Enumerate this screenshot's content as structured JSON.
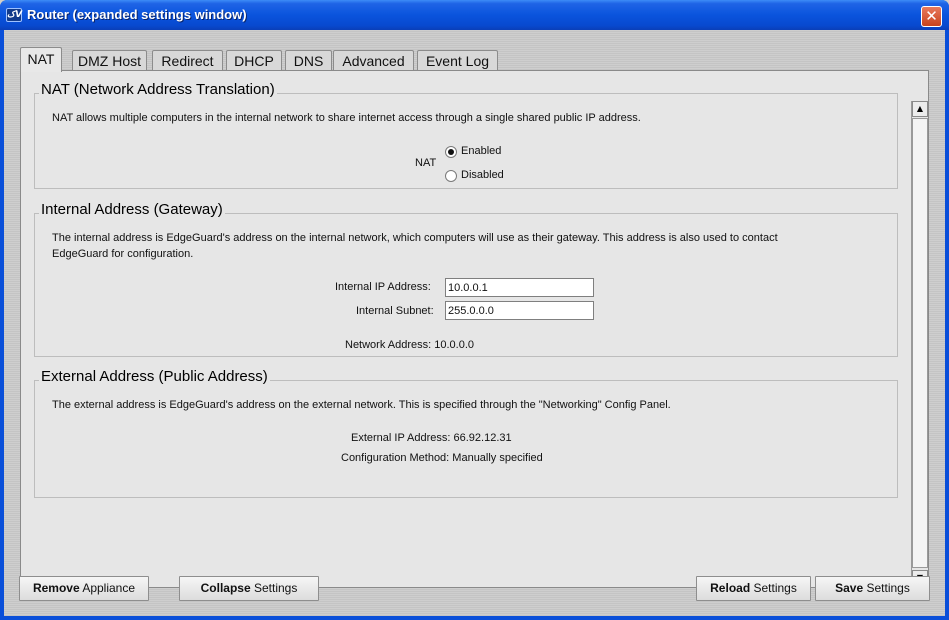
{
  "window": {
    "title": "Router (expanded settings window)",
    "app_icon_text": "کV",
    "close_glyph": "✕"
  },
  "tabs": [
    {
      "label": "NAT",
      "active": true
    },
    {
      "label": "DMZ Host"
    },
    {
      "label": "Redirect"
    },
    {
      "label": "DHCP"
    },
    {
      "label": "DNS"
    },
    {
      "label": "Advanced"
    },
    {
      "label": "Event Log"
    }
  ],
  "nat": {
    "title": "NAT (Network Address Translation)",
    "description": "NAT allows multiple computers in the internal network to share internet access through a single shared public IP address.",
    "field_label": "NAT",
    "options": [
      {
        "label": "Enabled",
        "selected": true
      },
      {
        "label": "Disabled",
        "selected": false
      }
    ]
  },
  "internal": {
    "title": "Internal Address (Gateway)",
    "description_line1": "The internal address is EdgeGuard's address on the internal network, which computers will use as their gateway.  This address is also used to contact",
    "description_line2": "EdgeGuard for configuration.",
    "ip_label": "Internal IP Address:",
    "ip_value": "10.0.0.1",
    "subnet_label": "Internal Subnet:",
    "subnet_value": "255.0.0.0",
    "network_address": "Network Address: 10.0.0.0"
  },
  "external": {
    "title": "External Address (Public Address)",
    "description": "The external address is EdgeGuard's address on the external network.  This is specified through the \"Networking\" Config Panel.",
    "ip_address": "External IP Address: 66.92.12.31",
    "config_method": "Configuration Method: Manually specified"
  },
  "buttons": {
    "remove": {
      "bold": "Remove",
      "rest": " Appliance"
    },
    "collapse": {
      "bold": "Collapse",
      "rest": " Settings"
    },
    "reload": {
      "bold": "Reload",
      "rest": " Settings"
    },
    "save": {
      "bold": "Save",
      "rest": " Settings"
    }
  },
  "scrollbar": {
    "up_glyph": "▲",
    "down_glyph": "▼"
  },
  "colors": {
    "titlebar": "#0a54dd",
    "close_button": "#c8431c",
    "panel": "#e6e6e6"
  }
}
